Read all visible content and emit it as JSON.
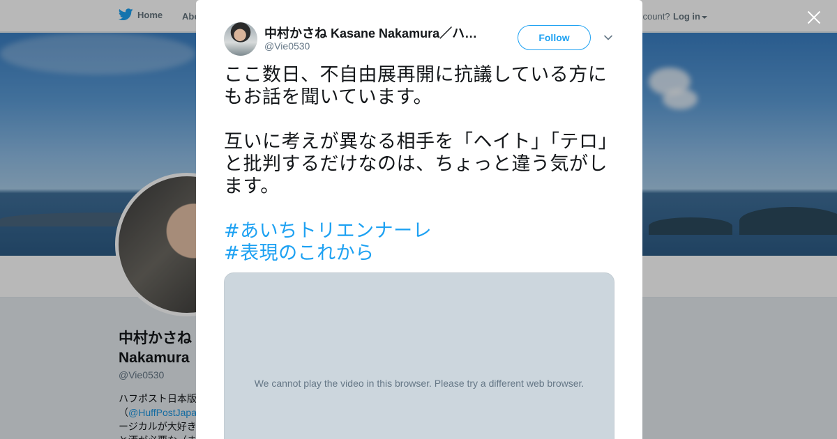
{
  "nav": {
    "home_label": "Home",
    "about_label": "Abo",
    "account_text": "ccount?",
    "login_label": "Log in"
  },
  "profile": {
    "name_line1": "中村かさね",
    "name_line2": "Nakamura",
    "handle": "@Vie0530",
    "bio_line1": "ハフポスト日本版",
    "bio_line2_prefix": "（",
    "bio_line2_link": "@HuffPostJapa",
    "bio_line3": "ージカルが大好き",
    "bio_line4": "と酒が必要な（ま"
  },
  "tweet": {
    "author_name": "中村かさね Kasane Nakamura／ハフポスト日本版",
    "author_handle": "@Vie0530",
    "follow_label": "Follow",
    "paragraph1": "ここ数日、不自由展再開に抗議している方にもお話を聞いています。",
    "paragraph2": "互いに考えが異なる相手を「ヘイト」「テロ」と批判するだけなのは、ちょっと違う気がします。",
    "hashtags": [
      "#あいちトリエンナーレ",
      "#表現のこれから"
    ],
    "video_message": "We cannot play the video in this browser. Please try a different web browser."
  },
  "colors": {
    "accent": "#1da1f2",
    "link": "#1b95e0",
    "video_bg": "#ccd6dd"
  },
  "icons": {
    "logo": "twitter-bird-icon",
    "close": "close-icon",
    "menu": "chevron-down-icon"
  }
}
